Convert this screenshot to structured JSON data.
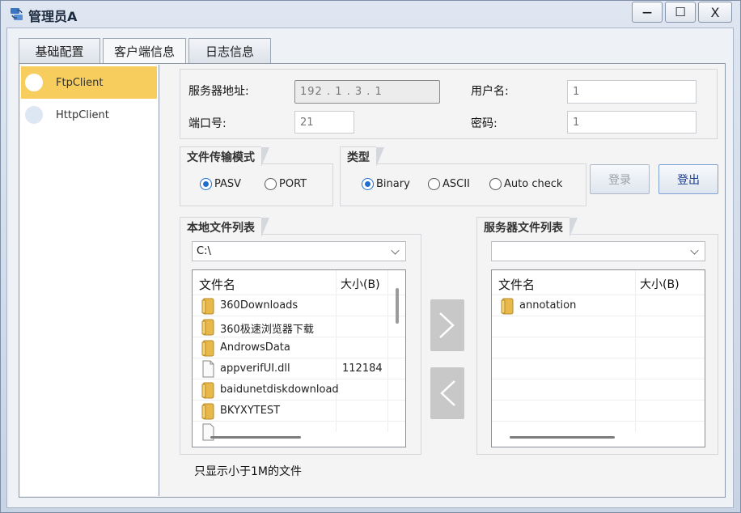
{
  "window": {
    "title": "管理员A",
    "minimize_label": "—",
    "maximize_label": "☐",
    "close_label": "X"
  },
  "tabs": [
    {
      "label": "基础配置",
      "active": false
    },
    {
      "label": "客户端信息",
      "active": true
    },
    {
      "label": "日志信息",
      "active": false
    }
  ],
  "sidebar": {
    "items": [
      {
        "label": "FtpClient",
        "active": true
      },
      {
        "label": "HttpClient",
        "active": false
      }
    ]
  },
  "server": {
    "address_label": "服务器地址:",
    "address_value": "192 . 1 . 3 . 1",
    "port_label": "端口号:",
    "port_value": "21",
    "username_label": "用户名:",
    "username_value": "1",
    "password_label": "密码:",
    "password_value": "1"
  },
  "transfer_mode": {
    "title": "文件传输模式",
    "options": [
      {
        "label": "PASV",
        "selected": true
      },
      {
        "label": "PORT",
        "selected": false
      }
    ]
  },
  "type": {
    "title": "类型",
    "options": [
      {
        "label": "Binary",
        "selected": true
      },
      {
        "label": "ASCII",
        "selected": false
      },
      {
        "label": "Auto check",
        "selected": false
      }
    ]
  },
  "buttons": {
    "login": "登录",
    "logout": "登出"
  },
  "local": {
    "title": "本地文件列表",
    "path": "C:\\",
    "columns": [
      "文件名",
      "大小(B)"
    ],
    "rows": [
      {
        "name": "360Downloads",
        "size": "",
        "icon": "folder-icon"
      },
      {
        "name": "360极速浏览器下载",
        "size": "",
        "icon": "folder-icon"
      },
      {
        "name": "AndrowsData",
        "size": "",
        "icon": "folder-icon"
      },
      {
        "name": "appverifUI.dll",
        "size": "112184",
        "icon": "file-icon"
      },
      {
        "name": "baidunetdiskdownload",
        "size": "",
        "icon": "folder-icon"
      },
      {
        "name": "BKYXYTEST",
        "size": "",
        "icon": "folder-icon"
      }
    ]
  },
  "server_files": {
    "title": "服务器文件列表",
    "path": "",
    "columns": [
      "文件名",
      "大小(B)"
    ],
    "rows": [
      {
        "name": "annotation",
        "size": "",
        "icon": "folder-icon"
      }
    ]
  },
  "note": "只显示小于1M的文件",
  "colors": {
    "active_item": "#f7ce5d",
    "radio_accent": "#1f6fd1",
    "folder": "#e7b84a"
  }
}
